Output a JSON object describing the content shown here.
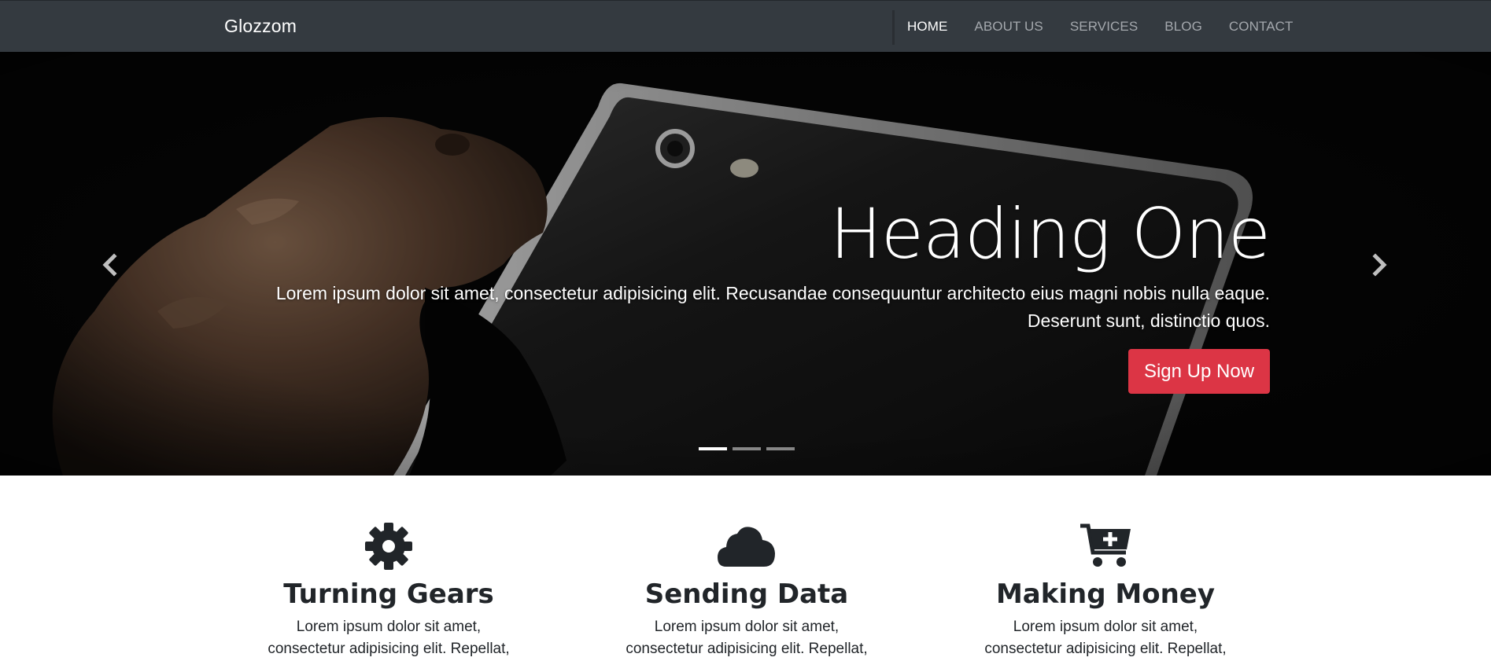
{
  "navbar": {
    "brand": "Glozzom",
    "links": [
      "HOME",
      "ABOUT US",
      "SERVICES",
      "BLOG",
      "CONTACT"
    ],
    "active_link": "HOME"
  },
  "hero": {
    "heading": "Heading One",
    "text": "Lorem ipsum dolor sit amet, consectetur adipisicing elit. Recusandae consequuntur architecto eius magni nobis nulla eaque. Deserunt sunt, distinctio quos.",
    "button_label": "Sign Up Now",
    "prev_icon": "chevron-left-icon",
    "next_icon": "chevron-right-icon",
    "slide_count": 3,
    "active_slide": 1
  },
  "features": [
    {
      "icon": "gear-icon",
      "title": "Turning Gears",
      "text": "Lorem ipsum dolor sit amet, consectetur adipisicing elit. Repellat, maxime."
    },
    {
      "icon": "cloud-icon",
      "title": "Sending Data",
      "text": "Lorem ipsum dolor sit amet, consectetur adipisicing elit. Repellat, maxime."
    },
    {
      "icon": "cart-plus-icon",
      "title": "Making Money",
      "text": "Lorem ipsum dolor sit amet, consectetur adipisicing elit. Repellat, maxime."
    }
  ],
  "colors": {
    "navbar_bg": "#343a40",
    "accent": "#dc3545",
    "text_dark": "#212529"
  }
}
